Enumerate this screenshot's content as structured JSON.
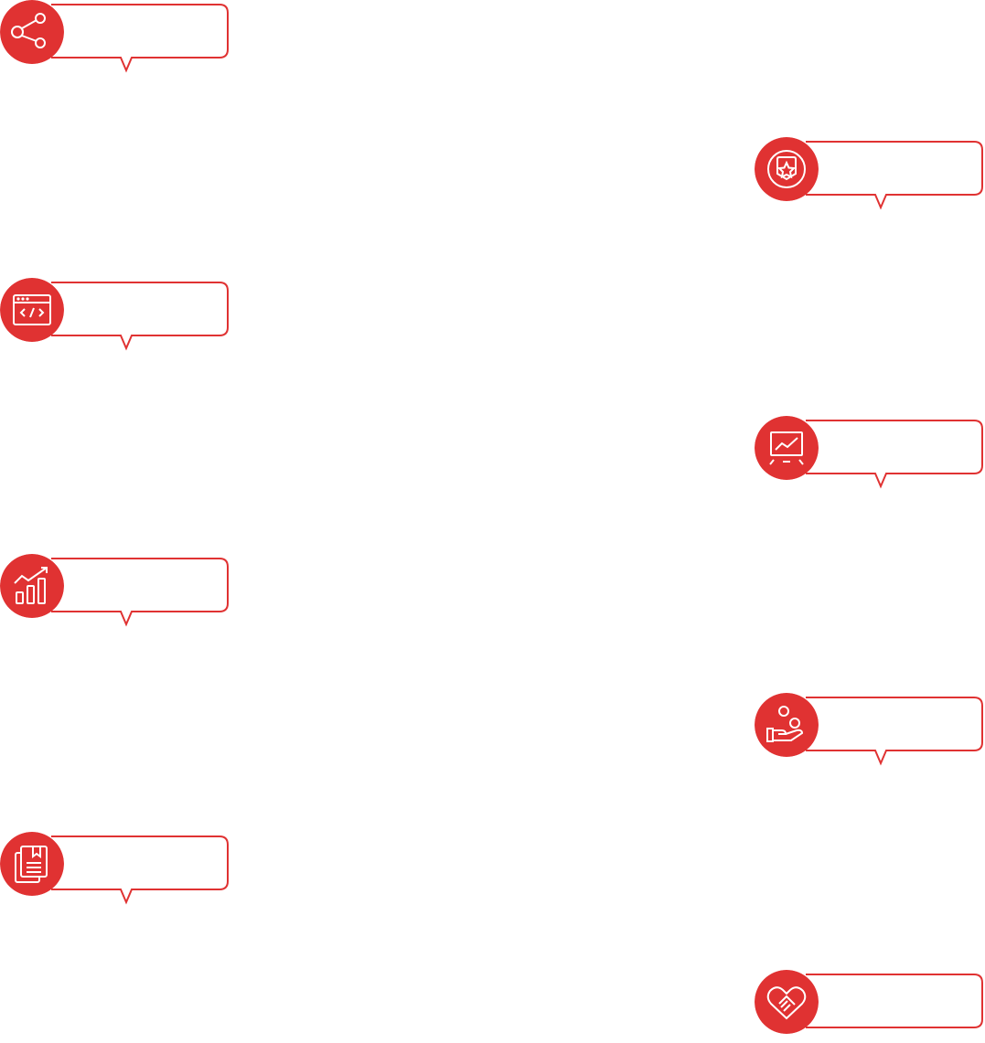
{
  "accent_color": "#e03232",
  "milestones": [
    {
      "id": "m1",
      "icon": "share-network-icon",
      "label": ""
    },
    {
      "id": "m2",
      "icon": "award-badge-star-icon",
      "label": ""
    },
    {
      "id": "m3",
      "icon": "browser-code-icon",
      "label": ""
    },
    {
      "id": "m4",
      "icon": "presentation-chart-icon",
      "label": ""
    },
    {
      "id": "m5",
      "icon": "growth-bar-chart-icon",
      "label": ""
    },
    {
      "id": "m6",
      "icon": "hand-coins-icon",
      "label": ""
    },
    {
      "id": "m7",
      "icon": "book-documents-icon",
      "label": ""
    },
    {
      "id": "m8",
      "icon": "heart-handshake-icon",
      "label": ""
    }
  ]
}
